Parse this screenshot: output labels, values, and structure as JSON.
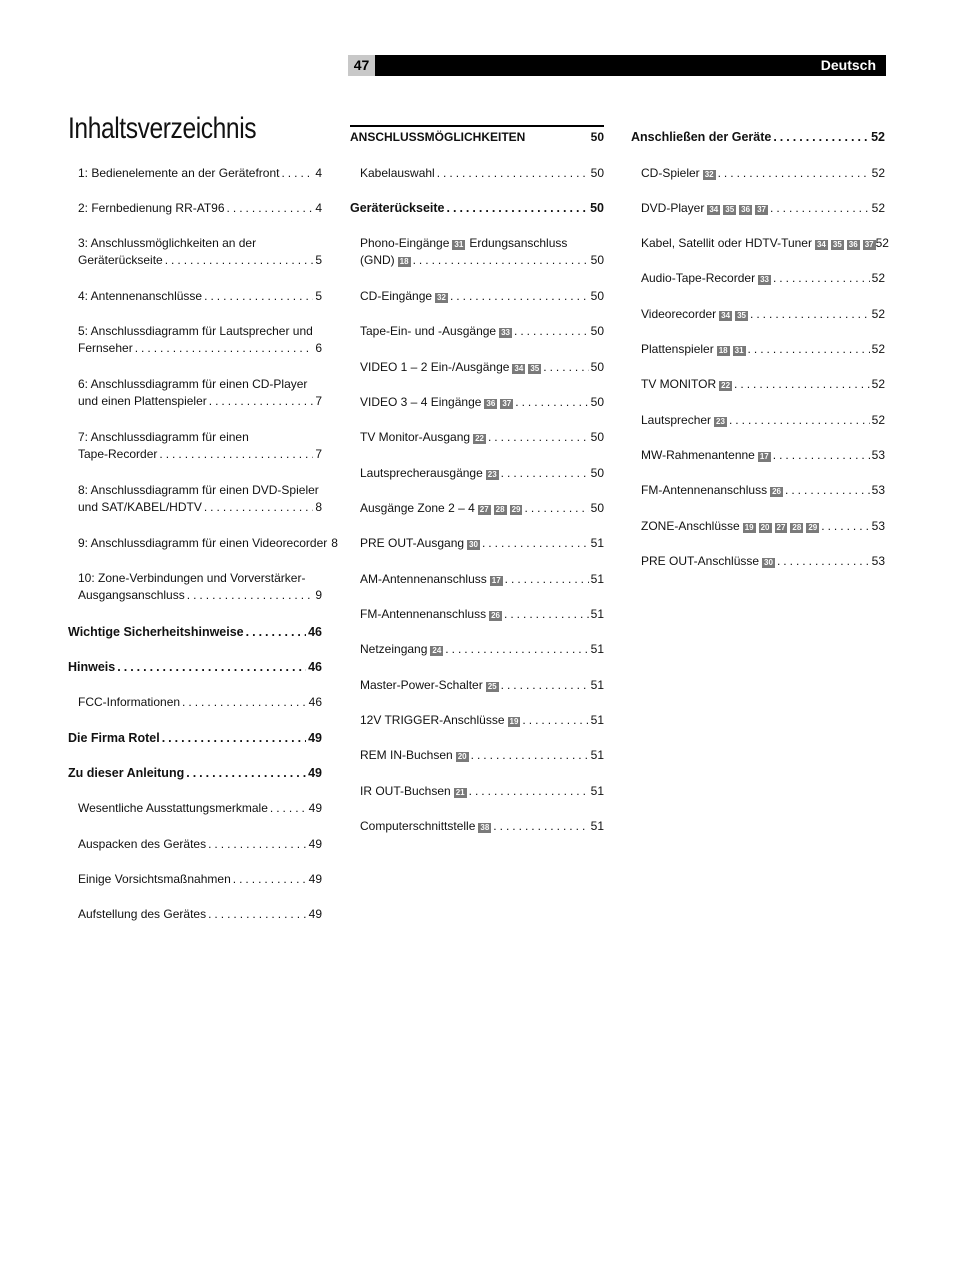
{
  "header": {
    "page_number": "47",
    "language": "Deutsch"
  },
  "title": "Inhaltsverzeichnis",
  "column1": [
    {
      "lines": [
        "1: Bedienelemente an der Gerätefront"
      ],
      "page": "4",
      "level": "sub"
    },
    {
      "lines": [
        "2: Fernbedienung RR-AT96"
      ],
      "page": "4",
      "level": "sub"
    },
    {
      "lines": [
        "3: Anschlussmöglichkeiten an der",
        "Geräterückseite"
      ],
      "page": "5",
      "level": "sub"
    },
    {
      "lines": [
        "4: Antennenanschlüsse"
      ],
      "page": "5",
      "level": "sub"
    },
    {
      "lines": [
        "5: Anschlussdiagramm für Lautsprecher und",
        "Fernseher"
      ],
      "page": "6",
      "level": "sub"
    },
    {
      "lines": [
        "6: Anschlussdiagramm für einen CD-Player",
        "und einen Plattenspieler"
      ],
      "page": "7",
      "level": "sub"
    },
    {
      "lines": [
        "7: Anschlussdiagramm für einen",
        "Tape-Recorder"
      ],
      "page": "7",
      "level": "sub"
    },
    {
      "lines": [
        "8: Anschlussdiagramm für einen DVD-Spieler",
        "und SAT/KABEL/HDTV"
      ],
      "page": "8",
      "level": "sub"
    },
    {
      "lines": [
        "9: Anschlussdiagramm für einen Videorecorder"
      ],
      "page": "8",
      "level": "sub"
    },
    {
      "lines": [
        "10: Zone-Verbindungen und Vorverstärker-",
        "Ausgangsanschluss"
      ],
      "page": "9",
      "level": "sub"
    },
    {
      "lines": [
        "Wichtige Sicherheitshinweise"
      ],
      "page": "46",
      "level": "bold"
    },
    {
      "lines": [
        "Hinweis"
      ],
      "page": "46",
      "level": "bold"
    },
    {
      "lines": [
        "FCC-Informationen"
      ],
      "page": "46",
      "level": "sub"
    },
    {
      "lines": [
        "Die Firma Rotel"
      ],
      "page": "49",
      "level": "bold"
    },
    {
      "lines": [
        "Zu dieser Anleitung"
      ],
      "page": "49",
      "level": "bold"
    },
    {
      "lines": [
        "Wesentliche Ausstattungsmerkmale"
      ],
      "page": "49",
      "level": "sub"
    },
    {
      "lines": [
        "Auspacken des Gerätes"
      ],
      "page": "49",
      "level": "sub"
    },
    {
      "lines": [
        "Einige Vorsichtsmaßnahmen"
      ],
      "page": "49",
      "level": "sub"
    },
    {
      "lines": [
        "Aufstellung des Gerätes"
      ],
      "page": "49",
      "level": "sub"
    }
  ],
  "column2": [
    {
      "lines": [
        "ANSCHLUSSMÖGLICHKEITEN"
      ],
      "page": "50",
      "level": "caps"
    },
    {
      "lines": [
        "Kabelauswahl"
      ],
      "page": "50",
      "level": "sub"
    },
    {
      "lines": [
        "Geräterückseite"
      ],
      "page": "50",
      "level": "bold"
    },
    {
      "lines": [
        "Phono-Eingänge",
        "(GND)"
      ],
      "badges_line1": [
        "31"
      ],
      "line1_suffix": "Erdungsanschluss",
      "badges": [
        "18"
      ],
      "page": "50",
      "level": "sub"
    },
    {
      "lines": [
        "CD-Eingänge"
      ],
      "badges": [
        "32"
      ],
      "page": "50",
      "level": "sub"
    },
    {
      "lines": [
        "Tape-Ein- und -Ausgänge"
      ],
      "badges": [
        "33"
      ],
      "page": "50",
      "level": "sub"
    },
    {
      "lines": [
        "VIDEO 1 – 2 Ein-/Ausgänge"
      ],
      "badges": [
        "34",
        "35"
      ],
      "page": "50",
      "level": "sub"
    },
    {
      "lines": [
        "VIDEO 3 – 4 Eingänge"
      ],
      "badges": [
        "36",
        "37"
      ],
      "page": "50",
      "level": "sub"
    },
    {
      "lines": [
        "TV Monitor-Ausgang"
      ],
      "badges": [
        "22"
      ],
      "page": "50",
      "level": "sub"
    },
    {
      "lines": [
        "Lautsprecherausgänge"
      ],
      "badges": [
        "23"
      ],
      "page": "50",
      "level": "sub"
    },
    {
      "lines": [
        "Ausgänge Zone 2 – 4"
      ],
      "badges": [
        "27",
        "28",
        "29"
      ],
      "page": "50",
      "level": "sub"
    },
    {
      "lines": [
        "PRE OUT-Ausgang"
      ],
      "badges": [
        "30"
      ],
      "page": "51",
      "level": "sub"
    },
    {
      "lines": [
        "AM-Antennenanschluss"
      ],
      "badges": [
        "17"
      ],
      "page": "51",
      "level": "sub"
    },
    {
      "lines": [
        "FM-Antennenanschluss"
      ],
      "badges": [
        "26"
      ],
      "page": "51",
      "level": "sub"
    },
    {
      "lines": [
        "Netzeingang"
      ],
      "badges": [
        "24"
      ],
      "page": "51",
      "level": "sub"
    },
    {
      "lines": [
        "Master-Power-Schalter"
      ],
      "badges": [
        "25"
      ],
      "page": "51",
      "level": "sub"
    },
    {
      "lines": [
        "12V TRIGGER-Anschlüsse"
      ],
      "badges": [
        "19"
      ],
      "page": "51",
      "level": "sub"
    },
    {
      "lines": [
        "REM IN-Buchsen"
      ],
      "badges": [
        "20"
      ],
      "page": "51",
      "level": "sub"
    },
    {
      "lines": [
        "IR OUT-Buchsen"
      ],
      "badges": [
        "21"
      ],
      "page": "51",
      "level": "sub"
    },
    {
      "lines": [
        "Computerschnittstelle"
      ],
      "badges": [
        "38"
      ],
      "page": "51",
      "level": "sub"
    }
  ],
  "column3": [
    {
      "lines": [
        "Anschließen der Geräte"
      ],
      "page": "52",
      "level": "bold"
    },
    {
      "lines": [
        "CD-Spieler"
      ],
      "badges": [
        "32"
      ],
      "page": "52",
      "level": "sub"
    },
    {
      "lines": [
        "DVD-Player"
      ],
      "badges": [
        "34",
        "35",
        "36",
        "37"
      ],
      "page": "52",
      "level": "sub"
    },
    {
      "lines": [
        "Kabel, Satellit oder HDTV-Tuner"
      ],
      "badges": [
        "34",
        "35",
        "36",
        "37"
      ],
      "page": "52",
      "level": "sub",
      "nodots": true
    },
    {
      "lines": [
        "Audio-Tape-Recorder"
      ],
      "badges": [
        "33"
      ],
      "page": "52",
      "level": "sub"
    },
    {
      "lines": [
        "Videorecorder"
      ],
      "badges": [
        "34",
        "35"
      ],
      "page": "52",
      "level": "sub"
    },
    {
      "lines": [
        "Plattenspieler"
      ],
      "badges": [
        "18",
        "31"
      ],
      "page": "52",
      "level": "sub"
    },
    {
      "lines": [
        "TV MONITOR"
      ],
      "badges": [
        "22"
      ],
      "page": "52",
      "level": "sub"
    },
    {
      "lines": [
        "Lautsprecher"
      ],
      "badges": [
        "23"
      ],
      "page": "52",
      "level": "sub"
    },
    {
      "lines": [
        "MW-Rahmenantenne"
      ],
      "badges": [
        "17"
      ],
      "page": "53",
      "level": "sub"
    },
    {
      "lines": [
        "FM-Antennenanschluss"
      ],
      "badges": [
        "26"
      ],
      "page": "53",
      "level": "sub"
    },
    {
      "lines": [
        "ZONE-Anschlüsse"
      ],
      "badges": [
        "19",
        "20",
        "27",
        "28",
        "29"
      ],
      "page": "53",
      "level": "sub"
    },
    {
      "lines": [
        "PRE OUT-Anschlüsse"
      ],
      "badges": [
        "30"
      ],
      "page": "53",
      "level": "sub"
    }
  ]
}
